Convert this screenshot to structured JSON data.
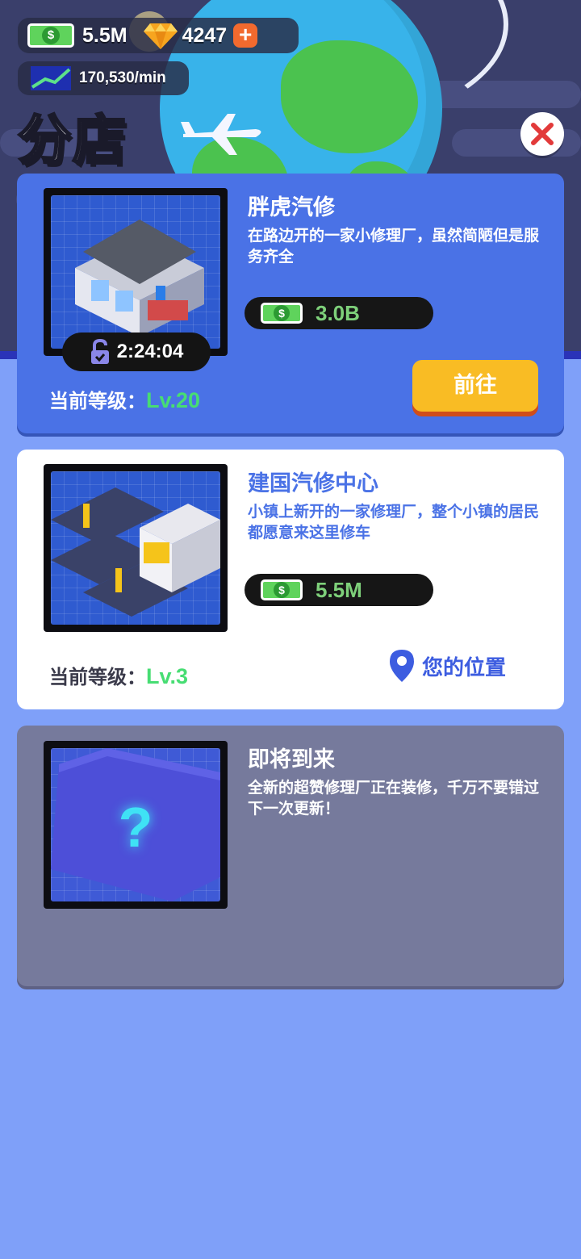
{
  "hud": {
    "cash": "5.5M",
    "gems": "4247",
    "plus": "+",
    "income_rate": "170,530/min"
  },
  "page": {
    "title": "分店"
  },
  "icons": {
    "cash": "cash-bill-icon",
    "gem": "gem-icon",
    "plus": "plus-icon",
    "income": "income-graph-icon",
    "close": "close-icon",
    "unlock": "padlock-unlock-icon",
    "location": "location-pin-icon",
    "unknown": "question-mark-icon"
  },
  "colors": {
    "card_active": "#4a72e6",
    "card_current": "#ffffff",
    "card_locked": "#767a9c",
    "level_value": "#47dd73",
    "price_value": "#7ed07a",
    "go_button": "#f9bc24",
    "location_text": "#3d5de0",
    "close_x": "#e23a3a"
  },
  "branches": [
    {
      "name": "胖虎汽修",
      "description": "在路边开的一家小修理厂，虽然简陋但是服务齐全",
      "price": "3.0B",
      "timer": "2:24:04",
      "level_label": "当前等级：",
      "level_value": "Lv.20",
      "action_label": "前往"
    },
    {
      "name": "建国汽修中心",
      "description": "小镇上新开的一家修理厂，整个小镇的居民都愿意来这里修车",
      "price": "5.5M",
      "level_label": "当前等级：",
      "level_value": "Lv.3",
      "location_label": "您的位置"
    },
    {
      "name": "即将到来",
      "description": "全新的超赞修理厂正在装修，千万不要错过下一次更新！",
      "placeholder_glyph": "?"
    }
  ]
}
